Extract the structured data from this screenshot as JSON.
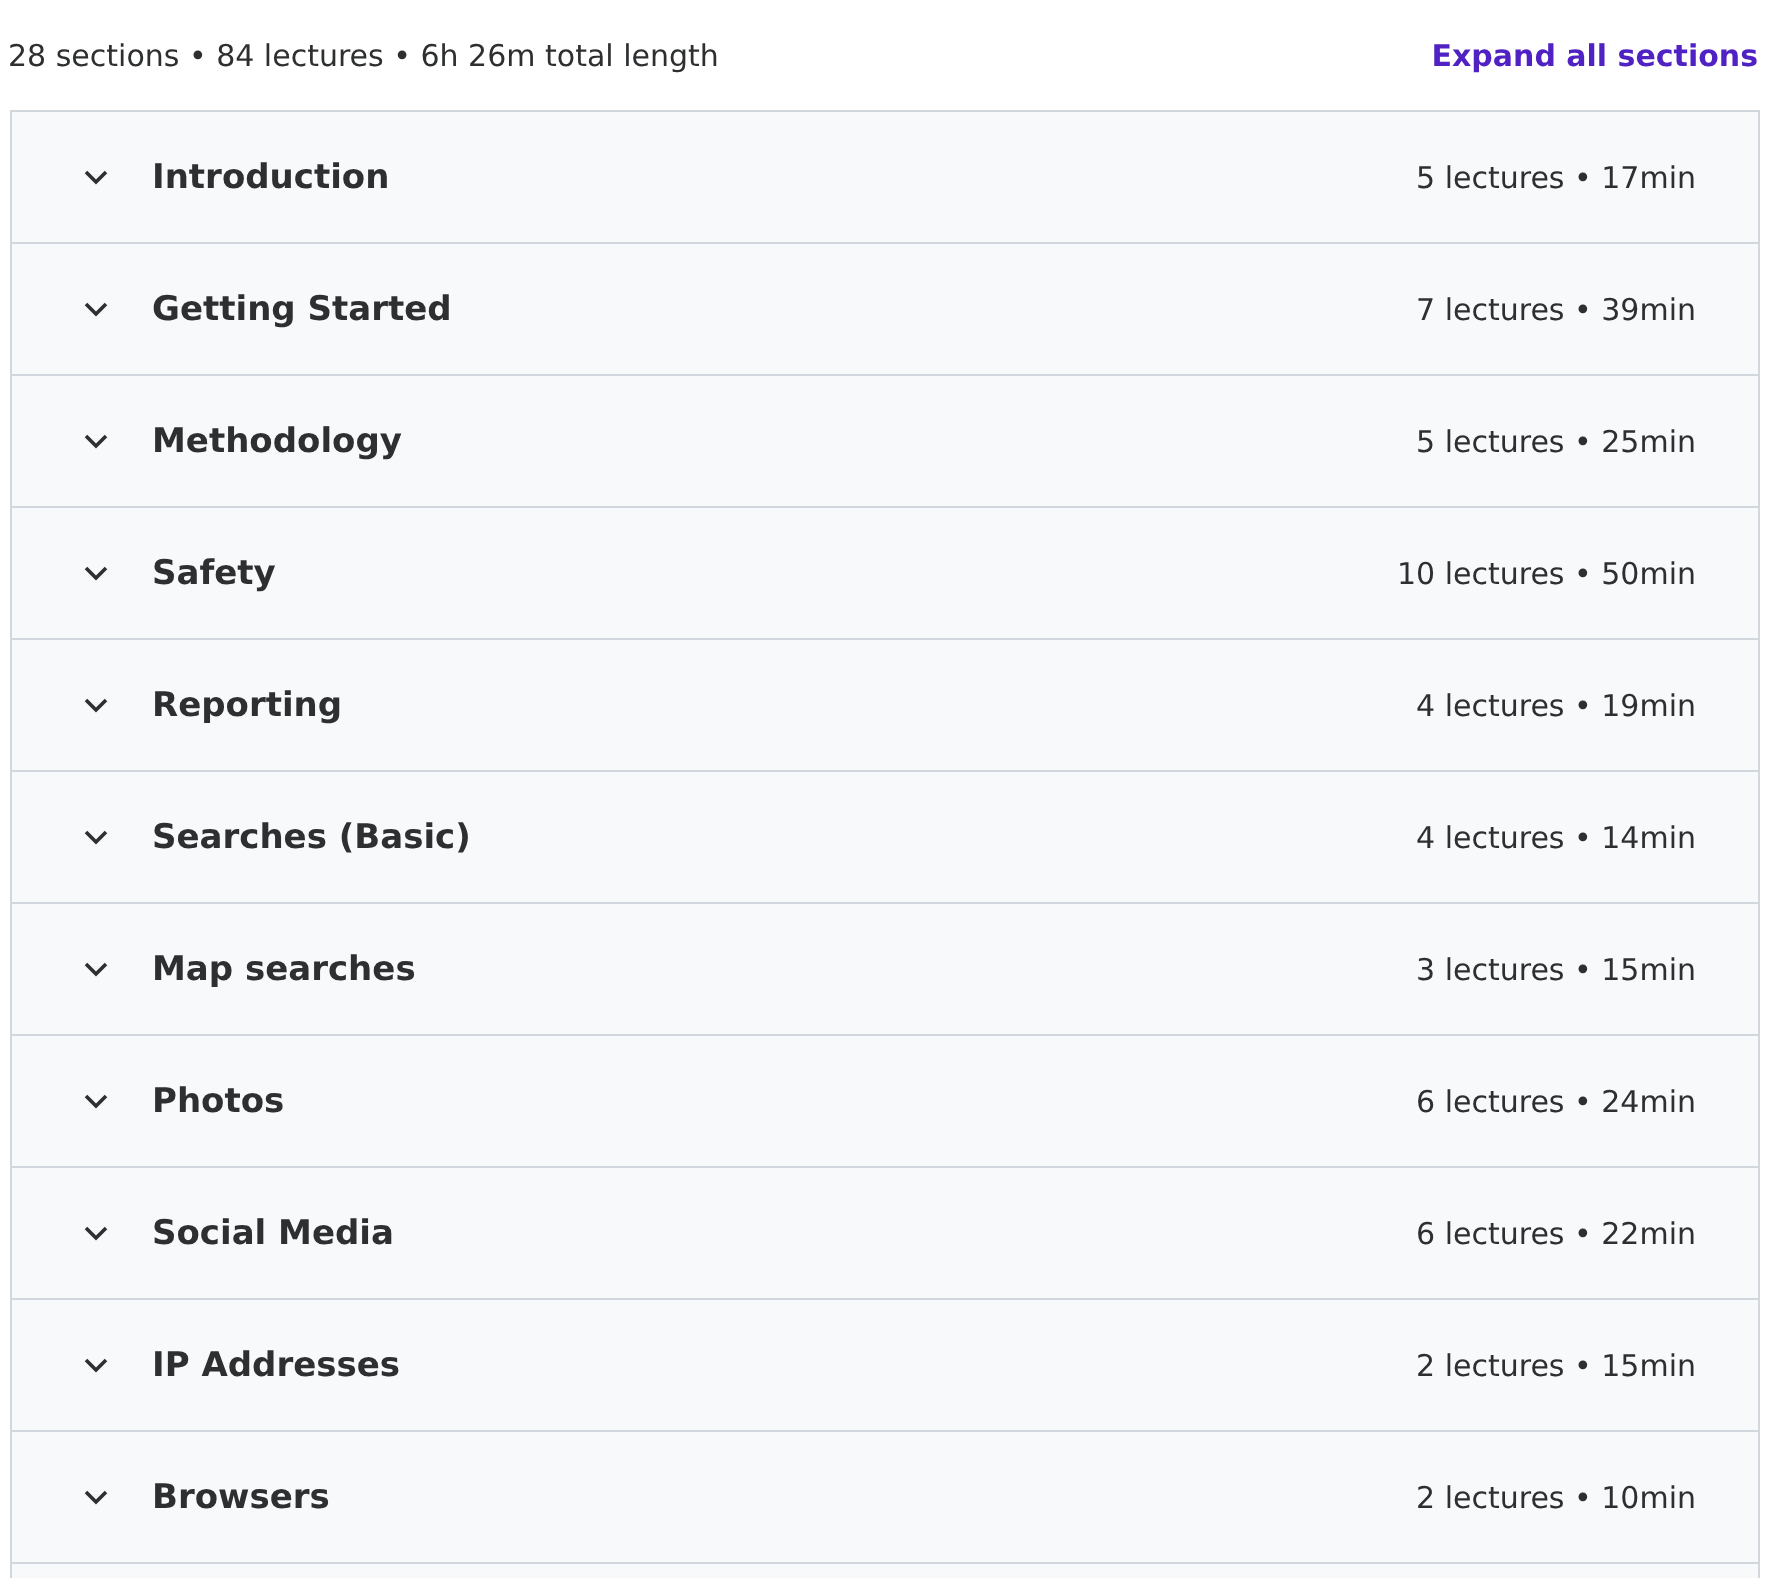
{
  "summary": "28 sections • 84 lectures • 6h 26m total length",
  "expand_all": "Expand all sections",
  "sections": [
    {
      "title": "Introduction",
      "meta": "5 lectures • 17min",
      "expanded": false
    },
    {
      "title": "Getting Started",
      "meta": "7 lectures • 39min",
      "expanded": false
    },
    {
      "title": "Methodology",
      "meta": "5 lectures • 25min",
      "expanded": false
    },
    {
      "title": "Safety",
      "meta": "10 lectures • 50min",
      "expanded": false
    },
    {
      "title": "Reporting",
      "meta": "4 lectures • 19min",
      "expanded": false
    },
    {
      "title": "Searches (Basic)",
      "meta": "4 lectures • 14min",
      "expanded": false
    },
    {
      "title": "Map searches",
      "meta": "3 lectures • 15min",
      "expanded": false
    },
    {
      "title": "Photos",
      "meta": "6 lectures • 24min",
      "expanded": false
    },
    {
      "title": "Social Media",
      "meta": "6 lectures • 22min",
      "expanded": false
    },
    {
      "title": "IP Addresses",
      "meta": "2 lectures • 15min",
      "expanded": false
    },
    {
      "title": "Browsers",
      "meta": "2 lectures • 10min",
      "expanded": false
    }
  ]
}
